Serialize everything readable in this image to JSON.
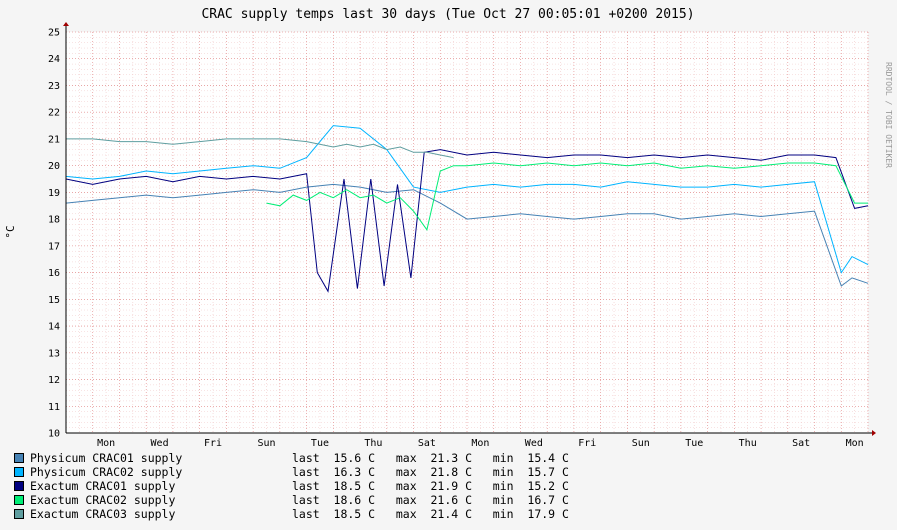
{
  "chart_data": {
    "type": "line",
    "title": "CRAC supply temps last 30 days (Tue Oct 27 00:05:01 +0200 2015)",
    "watermark": "RRDTOOL / TOBI OETIKER",
    "ylabel": "°C",
    "ylim": [
      10,
      25
    ],
    "yticks": [
      10,
      11,
      12,
      13,
      14,
      15,
      16,
      17,
      18,
      19,
      20,
      21,
      22,
      23,
      24,
      25
    ],
    "xlim_days": [
      0,
      30
    ],
    "xticks": [
      {
        "day": 1.5,
        "label": "Mon"
      },
      {
        "day": 3.5,
        "label": "Wed"
      },
      {
        "day": 5.5,
        "label": "Fri"
      },
      {
        "day": 7.5,
        "label": "Sun"
      },
      {
        "day": 9.5,
        "label": "Tue"
      },
      {
        "day": 11.5,
        "label": "Thu"
      },
      {
        "day": 13.5,
        "label": "Sat"
      },
      {
        "day": 15.5,
        "label": "Mon"
      },
      {
        "day": 17.5,
        "label": "Wed"
      },
      {
        "day": 19.5,
        "label": "Fri"
      },
      {
        "day": 21.5,
        "label": "Sun"
      },
      {
        "day": 23.5,
        "label": "Tue"
      },
      {
        "day": 25.5,
        "label": "Thu"
      },
      {
        "day": 27.5,
        "label": "Sat"
      },
      {
        "day": 29.5,
        "label": "Mon"
      }
    ],
    "grid": true,
    "series": [
      {
        "name": "Physicum CRAC01 supply",
        "color": "#4682b4",
        "x": [
          0,
          1,
          2,
          3,
          4,
          5,
          6,
          7,
          8,
          9,
          10,
          11,
          12,
          13,
          14,
          15,
          16,
          17,
          18,
          19,
          20,
          21,
          22,
          23,
          24,
          25,
          26,
          27,
          28,
          29,
          29.4,
          30
        ],
        "y": [
          18.6,
          18.7,
          18.8,
          18.9,
          18.8,
          18.9,
          19.0,
          19.1,
          19.0,
          19.2,
          19.3,
          19.2,
          19.0,
          19.1,
          18.6,
          18.0,
          18.1,
          18.2,
          18.1,
          18.0,
          18.1,
          18.2,
          18.2,
          18.0,
          18.1,
          18.2,
          18.1,
          18.2,
          18.3,
          15.5,
          15.8,
          15.6
        ],
        "last": "15.6",
        "max": "21.3",
        "min": "15.4"
      },
      {
        "name": "Physicum CRAC02 supply",
        "color": "#00b4ff",
        "x": [
          0,
          1,
          2,
          3,
          4,
          5,
          6,
          7,
          8,
          9,
          10,
          11,
          12,
          13,
          14,
          15,
          16,
          17,
          18,
          19,
          20,
          21,
          22,
          23,
          24,
          25,
          26,
          27,
          28,
          29,
          29.4,
          30
        ],
        "y": [
          19.6,
          19.5,
          19.6,
          19.8,
          19.7,
          19.8,
          19.9,
          20.0,
          19.9,
          20.3,
          21.5,
          21.4,
          20.6,
          19.2,
          19.0,
          19.2,
          19.3,
          19.2,
          19.3,
          19.3,
          19.2,
          19.4,
          19.3,
          19.2,
          19.2,
          19.3,
          19.2,
          19.3,
          19.4,
          16.0,
          16.6,
          16.3
        ],
        "last": "16.3",
        "max": "21.8",
        "min": "15.7"
      },
      {
        "name": "Exactum CRAC01 supply",
        "color": "#000080",
        "x": [
          0,
          1,
          2,
          3,
          4,
          5,
          6,
          7,
          8,
          9,
          9.4,
          9.8,
          10.4,
          10.9,
          11.4,
          11.9,
          12.4,
          12.9,
          13.4,
          14,
          15,
          16,
          17,
          18,
          19,
          20,
          21,
          22,
          23,
          24,
          25,
          26,
          27,
          28,
          28.8,
          29.5,
          30
        ],
        "y": [
          19.5,
          19.3,
          19.5,
          19.6,
          19.4,
          19.6,
          19.5,
          19.6,
          19.5,
          19.7,
          16.0,
          15.3,
          19.5,
          15.4,
          19.5,
          15.5,
          19.3,
          15.8,
          20.5,
          20.6,
          20.4,
          20.5,
          20.4,
          20.3,
          20.4,
          20.4,
          20.3,
          20.4,
          20.3,
          20.4,
          20.3,
          20.2,
          20.4,
          20.4,
          20.3,
          18.4,
          18.5
        ],
        "last": "18.5",
        "max": "21.9",
        "min": "15.2"
      },
      {
        "name": "Exactum CRAC02 supply",
        "color": "#00ee76",
        "x": [
          0,
          7.5,
          8,
          8.5,
          9,
          9.5,
          10,
          10.5,
          11,
          11.5,
          12,
          12.5,
          13,
          13.5,
          14,
          14.5,
          15,
          16,
          17,
          18,
          19,
          20,
          21,
          22,
          23,
          24,
          25,
          26,
          27,
          28,
          28.8,
          29.5,
          30
        ],
        "y": [
          null,
          18.6,
          18.5,
          18.9,
          18.7,
          19.0,
          18.8,
          19.1,
          18.8,
          18.9,
          18.6,
          18.8,
          18.3,
          17.6,
          19.8,
          20.0,
          20.0,
          20.1,
          20.0,
          20.1,
          20.0,
          20.1,
          20.0,
          20.1,
          19.9,
          20.0,
          19.9,
          20.0,
          20.1,
          20.1,
          20.0,
          18.6,
          18.6
        ],
        "last": "18.6",
        "max": "21.6",
        "min": "16.7"
      },
      {
        "name": "Exactum CRAC03 supply",
        "color": "#5f9ea0",
        "x": [
          0,
          1,
          2,
          3,
          4,
          5,
          6,
          7,
          8,
          9,
          10,
          10.5,
          11,
          11.5,
          12,
          12.5,
          13,
          13.5,
          14,
          14.5
        ],
        "y": [
          21.0,
          21.0,
          20.9,
          20.9,
          20.8,
          20.9,
          21.0,
          21.0,
          21.0,
          20.9,
          20.7,
          20.8,
          20.7,
          20.8,
          20.6,
          20.7,
          20.5,
          20.5,
          20.4,
          20.3
        ],
        "last": "18.5",
        "max": "21.4",
        "min": "17.9"
      }
    ]
  },
  "legend_labels": {
    "last": "last",
    "max": "max",
    "min": "min",
    "unit": "C"
  }
}
